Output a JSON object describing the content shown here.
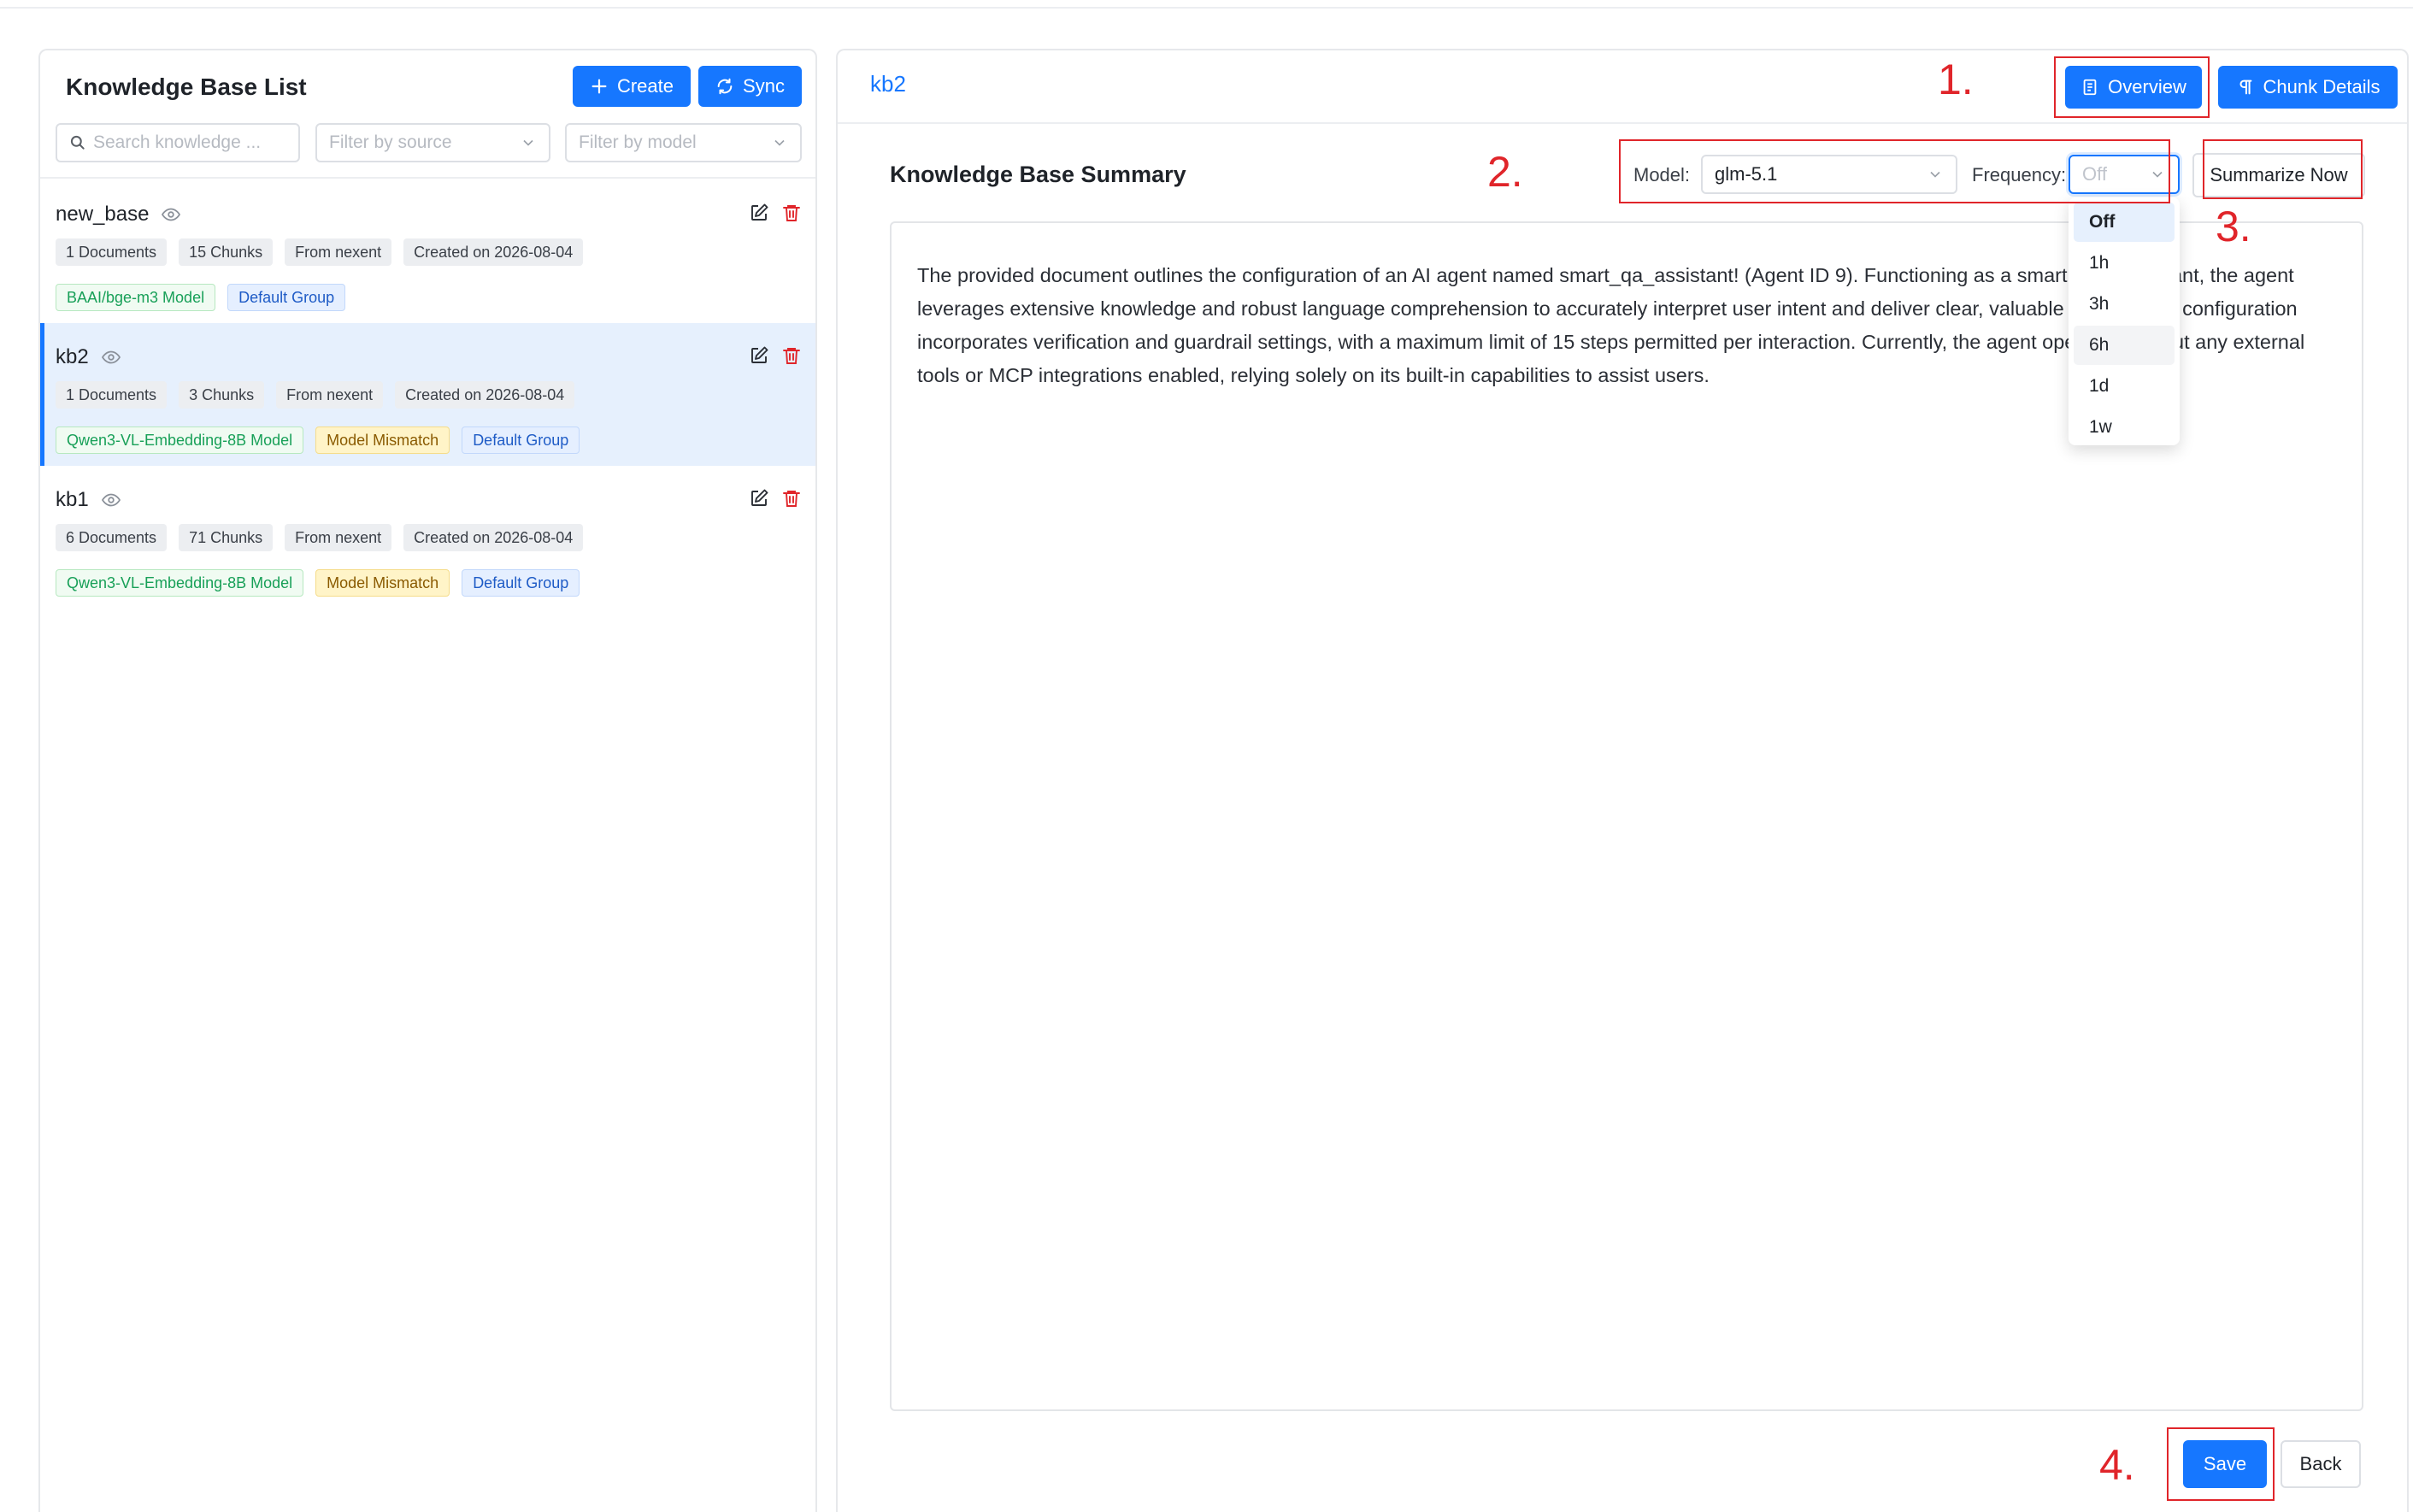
{
  "left": {
    "title": "Knowledge Base List",
    "create_label": "Create",
    "sync_label": "Sync",
    "search_placeholder": "Search knowledge ...",
    "filter_source_placeholder": "Filter by source",
    "filter_model_placeholder": "Filter by model",
    "items": [
      {
        "name": "new_base",
        "tags": [
          "1 Documents",
          "15 Chunks",
          "From nexent",
          "Created on 2026-08-04"
        ],
        "model": "BAAI/bge-m3 Model",
        "group": "Default Group"
      },
      {
        "name": "kb2",
        "tags": [
          "1 Documents",
          "3 Chunks",
          "From nexent",
          "Created on 2026-08-04"
        ],
        "model": "Qwen3-VL-Embedding-8B Model",
        "mismatch": "Model Mismatch",
        "group": "Default Group"
      },
      {
        "name": "kb1",
        "tags": [
          "6 Documents",
          "71 Chunks",
          "From nexent",
          "Created on 2026-08-04"
        ],
        "model": "Qwen3-VL-Embedding-8B Model",
        "mismatch": "Model Mismatch",
        "group": "Default Group"
      }
    ]
  },
  "right": {
    "breadcrumb": "kb2",
    "overview_label": "Overview",
    "chunk_details_label": "Chunk Details",
    "summary_title": "Knowledge Base Summary",
    "model_label": "Model:",
    "model_value": "glm-5.1",
    "frequency_label": "Frequency:",
    "frequency_value": "Off",
    "summarize_now_label": "Summarize Now",
    "summary_text": "The provided document outlines the configuration of an AI agent named smart_qa_assistant! (Agent ID 9). Functioning as a smart Q&A assistant, the agent leverages extensive knowledge and robust language comprehension to accurately interpret user intent and deliver clear, valuable answers. Its configuration incorporates verification and guardrail settings, with a maximum limit of 15 steps permitted per interaction. Currently, the agent operates without any external tools or MCP integrations enabled, relying solely on its built-in capabilities to assist users.",
    "frequency_options": [
      "Off",
      "1h",
      "3h",
      "6h",
      "1d",
      "1w"
    ],
    "save_label": "Save",
    "back_label": "Back"
  },
  "annotations": [
    "1.",
    "2.",
    "3.",
    "4."
  ],
  "colors": {
    "primary": "#1677ff",
    "annotation": "#e0252a",
    "selected_bg": "#e6f0fd"
  }
}
